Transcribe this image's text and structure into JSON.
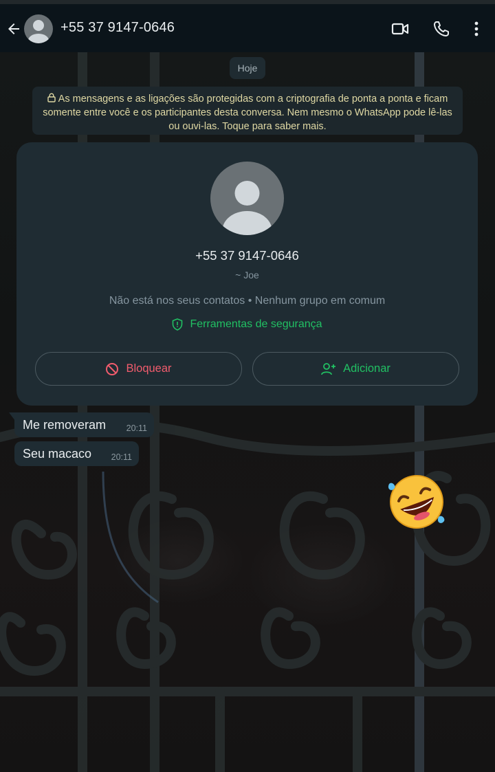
{
  "header": {
    "title": "+55 37 9147-0646",
    "back_icon": "arrow-left-icon",
    "actions": [
      "video-call-icon",
      "voice-call-icon",
      "more-options-icon"
    ]
  },
  "chat": {
    "date_chip": "Hoje",
    "encryption_notice": "As mensagens e as ligações são protegidas com a criptografia de ponta a ponta e ficam somente entre você e os participantes desta conversa. Nem mesmo o WhatsApp pode lê-las ou ouvi-las. Toque para saber mais.",
    "contact_card": {
      "phone": "+55 37 9147-0646",
      "push_name": "~ Joe",
      "subtitle": "Não está nos seus contatos • Nenhum grupo em comum",
      "safety_link": "Ferramentas de segurança",
      "block_label": "Bloquear",
      "add_label": "Adicionar"
    },
    "messages": [
      {
        "text": "Me removeram",
        "time": "20:11",
        "direction": "incoming"
      },
      {
        "text": "Seu macaco",
        "time": "20:11",
        "direction": "incoming"
      },
      {
        "emoji": "🤣",
        "direction": "outgoing"
      }
    ]
  },
  "colors": {
    "header_bg": "#0b141a",
    "bubble_bg": "#1f2c33",
    "accent_green": "#21c063",
    "danger_red": "#f15c6d",
    "notice_text": "#e0d9a4"
  }
}
